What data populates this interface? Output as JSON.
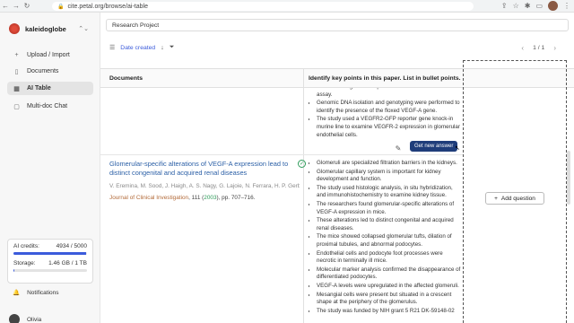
{
  "browser": {
    "url": "cite.petal.org/browse/ai-table"
  },
  "brand": {
    "name": "kaleidoglobe"
  },
  "sidebar": {
    "items": [
      {
        "label": "Upload / Import",
        "icon": "plus-icon"
      },
      {
        "label": "Documents",
        "icon": "document-icon"
      },
      {
        "label": "AI Table",
        "icon": "table-icon",
        "active": true
      },
      {
        "label": "Multi-doc Chat",
        "icon": "chat-icon"
      }
    ],
    "credits_label": "AI credits:",
    "credits_value": "4934 / 5000",
    "credits_fraction": 0.987,
    "storage_label": "Storage:",
    "storage_value": "1.46 GB / 1 TB",
    "storage_fraction": 0.0015,
    "notifications_label": "Notifications",
    "user_name": "Olivia"
  },
  "main": {
    "project": "Research Project",
    "sort_label": "Date created",
    "pager": "1 / 1",
    "col_documents": "Documents",
    "col_question": "Identify key points in this paper. List in bullet points.",
    "add_question": "Add question",
    "generate_button": "Get new answer"
  },
  "row1_bullets": [
    "detected using a urine dipstick and a standard colorimetric assay.",
    "Genomic DNA isolation and genotyping were performed to identify the presence of the floxed VEGF-A gene.",
    "The study used a VEGFR2-GFP reporter gene knock-in murine line to examine VEGFR-2 expression in glomerular endothelial cells."
  ],
  "document": {
    "title": "Glomerular-specific alterations of VEGF-A expression lead to distinct congenital and acquired renal diseases",
    "authors": "V. Eremina, M. Sood, J. Haigh, A. S. Nagy, G. Lajoie, N. Ferrara, H. P. Gerber,...",
    "journal": "Journal of Clinical Investigation",
    "volume": ", 111 (",
    "year": "2003",
    "pages": "), pp. 707–716."
  },
  "row2_bullets": [
    "Glomeruli are specialized filtration barriers in the kidneys.",
    "Glomerular capillary system is important for kidney development and function.",
    "The study used histologic analysis, in situ hybridization, and immunohistochemistry to examine kidney tissue.",
    "The researchers found glomerular-specific alterations of VEGF-A expression in mice.",
    "These alterations led to distinct congenital and acquired renal diseases.",
    "The mice showed collapsed glomerular tufts, dilation of proximal tubules, and abnormal podocytes.",
    "Endothelial cells and podocyte foot processes were necrotic in terminally ill mice.",
    "Molecular marker analysis confirmed the disappearance of differentiated podocytes.",
    "VEGF-A levels were upregulated in the affected glomeruli.",
    "Mesangial cells were present but situated in a crescent shape at the periphery of the glomerulus.",
    "The study was funded by NIH grant 5 R21 DK-59148-02"
  ]
}
